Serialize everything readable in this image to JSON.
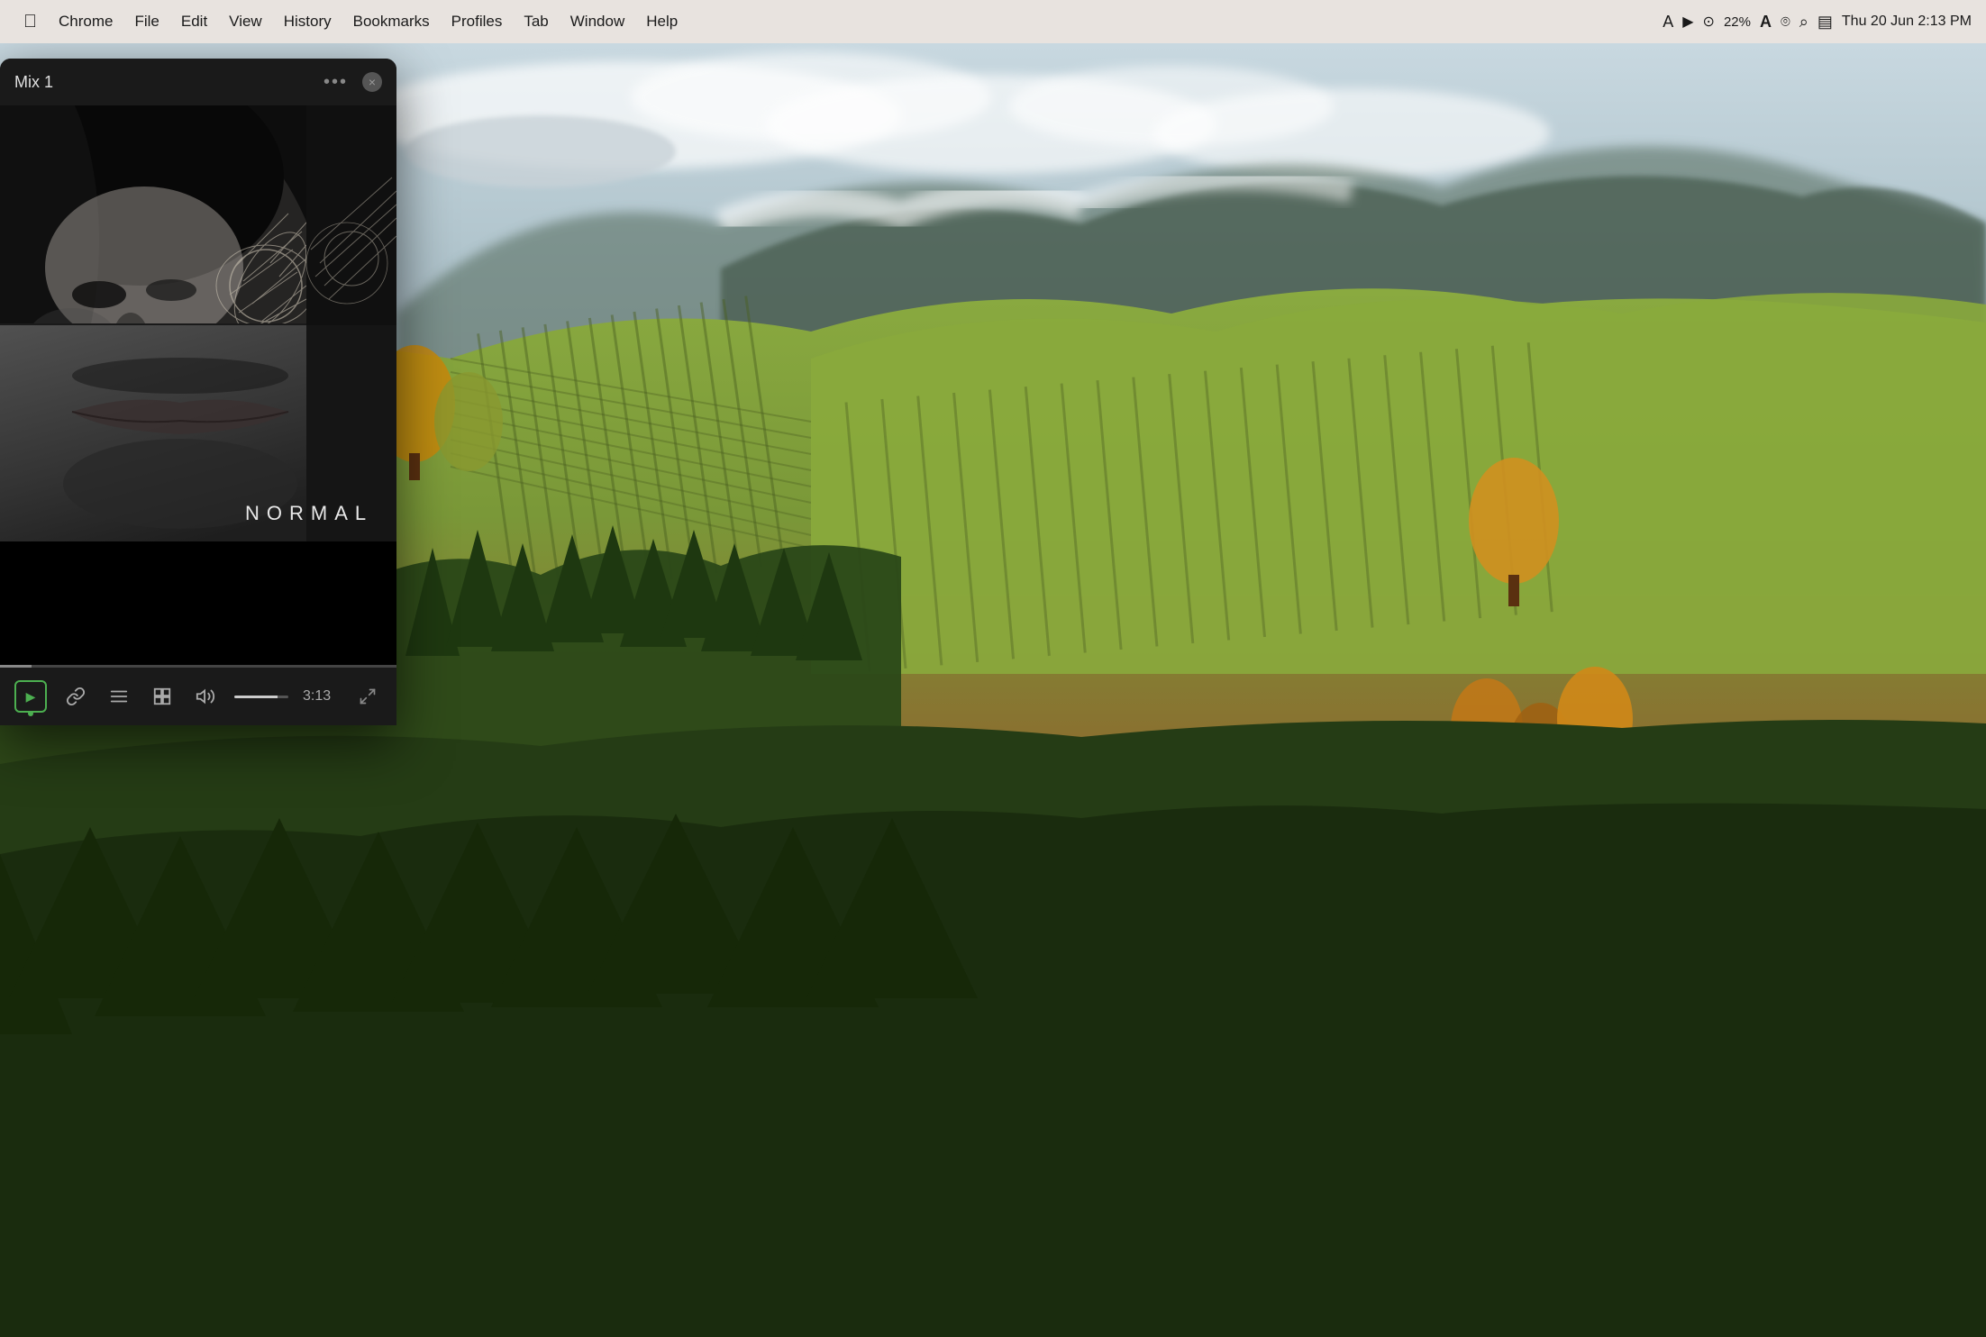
{
  "menubar": {
    "apple": "⌘",
    "items": [
      {
        "label": "Chrome",
        "id": "chrome"
      },
      {
        "label": "File",
        "id": "file"
      },
      {
        "label": "Edit",
        "id": "edit"
      },
      {
        "label": "View",
        "id": "view"
      },
      {
        "label": "History",
        "id": "history"
      },
      {
        "label": "Bookmarks",
        "id": "bookmarks"
      },
      {
        "label": "Profiles",
        "id": "profiles"
      },
      {
        "label": "Tab",
        "id": "tab"
      },
      {
        "label": "Window",
        "id": "window"
      },
      {
        "label": "Help",
        "id": "help"
      }
    ],
    "right": {
      "battery_percent": "22%",
      "datetime": "Thu 20 Jun  2:13 PM"
    }
  },
  "player": {
    "title": "Mix 1",
    "more_button": "•••",
    "close_button": "×",
    "art_label": "NORMAL",
    "time_current": "3:13",
    "controls": {
      "play": "▶",
      "link": "🔗",
      "list": "≡",
      "layout": "⊞",
      "volume": "🔊",
      "expand": "⤢"
    }
  },
  "desktop": {
    "bg_desc": "Vineyard landscape with rolling hills and forest"
  }
}
